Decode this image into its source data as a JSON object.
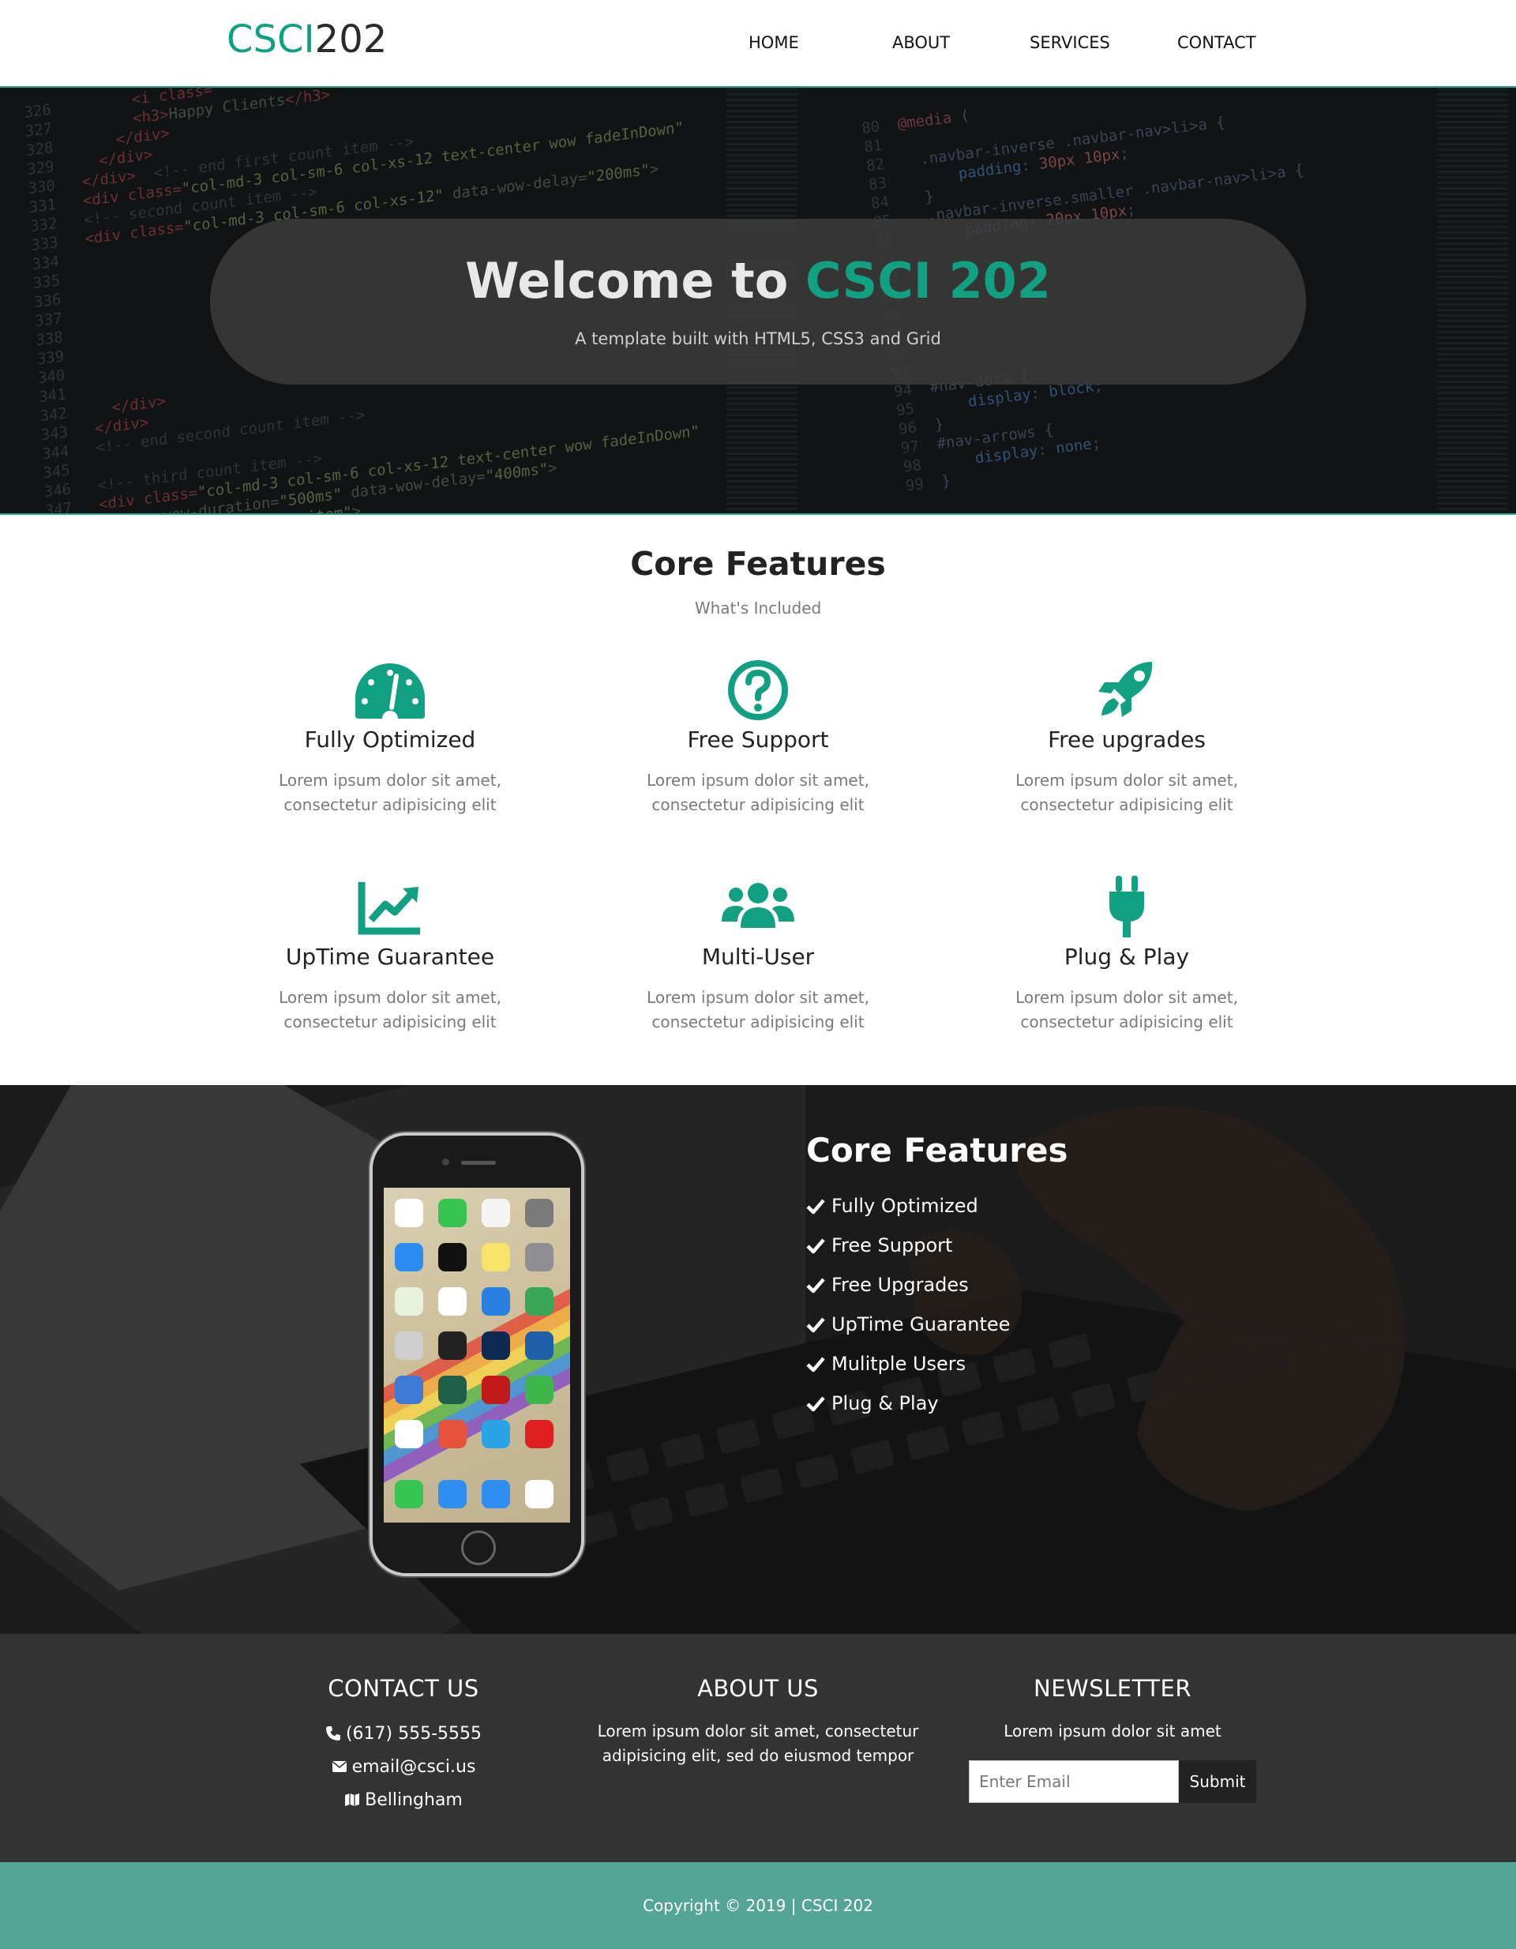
{
  "brand": {
    "accent": "CSCI",
    "rest": "202"
  },
  "nav": [
    {
      "label": "HOME"
    },
    {
      "label": "ABOUT"
    },
    {
      "label": "SERVICES"
    },
    {
      "label": "CONTACT"
    }
  ],
  "hero": {
    "title_prefix": "Welcome to",
    "title_accent": "CSCI 202",
    "subtitle": "A template built with HTML5, CSS3 and Grid"
  },
  "features": {
    "title": "Core Features",
    "subtitle": "What's Included",
    "items": [
      {
        "icon": "speedometer-icon",
        "name": "Fully Optimized",
        "desc": "Lorem ipsum dolor sit amet, consectetur adipisicing elit"
      },
      {
        "icon": "question-circle-icon",
        "name": "Free Support",
        "desc": "Lorem ipsum dolor sit amet, consectetur adipisicing elit"
      },
      {
        "icon": "rocket-icon",
        "name": "Free upgrades",
        "desc": "Lorem ipsum dolor sit amet, consectetur adipisicing elit"
      },
      {
        "icon": "chart-line-icon",
        "name": "UpTime Guarantee",
        "desc": "Lorem ipsum dolor sit amet, consectetur adipisicing elit"
      },
      {
        "icon": "users-icon",
        "name": "Multi-User",
        "desc": "Lorem ipsum dolor sit amet, consectetur adipisicing elit"
      },
      {
        "icon": "plug-icon",
        "name": "Plug & Play",
        "desc": "Lorem ipsum dolor sit amet, consectetur adipisicing elit"
      }
    ]
  },
  "showcase": {
    "title": "Core Features",
    "list": [
      "Fully Optimized",
      "Free Support",
      "Free Upgrades",
      "UpTime Guarantee",
      "Mulitple Users",
      "Plug & Play"
    ]
  },
  "footer": {
    "contact": {
      "title": "CONTACT US",
      "phone": "(617) 555-5555",
      "email": "email@csci.us",
      "location": "Bellingham"
    },
    "about": {
      "title": "ABOUT US",
      "text": "Lorem ipsum dolor sit amet, consectetur adipisicing elit, sed do eiusmod tempor"
    },
    "newsletter": {
      "title": "NEWSLETTER",
      "text": "Lorem ipsum dolor sit amet",
      "placeholder": "Enter Email",
      "button": "Submit"
    }
  },
  "copyright": "Copyright © 2019 | CSCI 202",
  "colors": {
    "accent": "#12a083",
    "footer": "#333333",
    "copyright_bar": "#55a597"
  }
}
